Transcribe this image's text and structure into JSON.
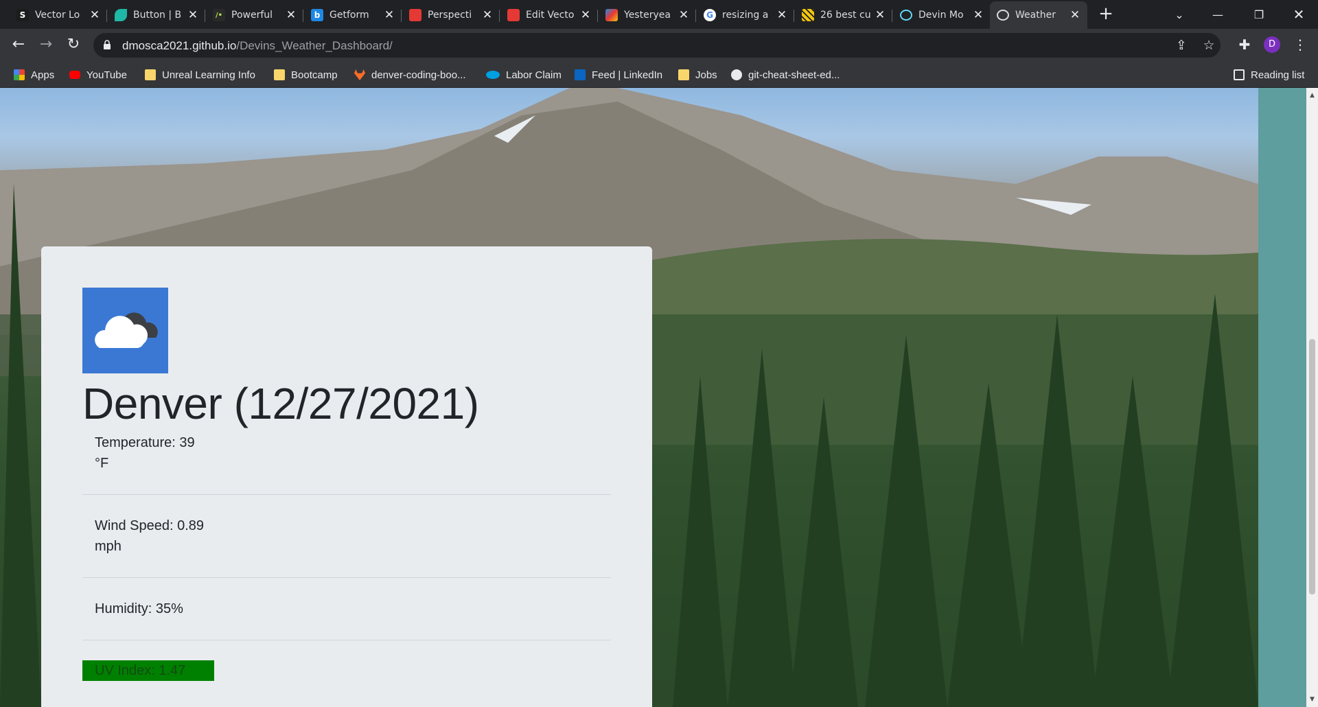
{
  "browser": {
    "tabs": [
      {
        "title": "Vector Lo",
        "favicon": "S",
        "color": "#1c1c1c"
      },
      {
        "title": "Button | B",
        "favicon": "",
        "color": "#1fb7a6"
      },
      {
        "title": "Powerful",
        "favicon": "/•",
        "color": "#2a2a2a"
      },
      {
        "title": "Getform",
        "favicon": "b",
        "color": "#1e88e5"
      },
      {
        "title": "Perspecti",
        "favicon": "",
        "color": "#e53935"
      },
      {
        "title": "Edit Vecto",
        "favicon": "",
        "color": "#e53935"
      },
      {
        "title": "Yesteryea",
        "favicon": "",
        "color": "#7b3fbf"
      },
      {
        "title": "resizing a",
        "favicon": "G",
        "color": "#ffffff"
      },
      {
        "title": "26 best cu",
        "favicon": "",
        "color": "#f2c511"
      },
      {
        "title": "Devin Mo",
        "favicon": "",
        "color": "#61dafb"
      },
      {
        "title": "Weather",
        "favicon": "",
        "color": "#9aa0a6"
      }
    ],
    "url_host": "dmosca2021.github.io",
    "url_path": "/Devins_Weather_Dashboard/",
    "profile_initial": "D",
    "bookmarks": [
      {
        "label": "Apps",
        "icon": "apps-grid-icon"
      },
      {
        "label": "YouTube",
        "icon": "youtube-icon"
      },
      {
        "label": "Unreal Learning Info",
        "icon": "folder-icon"
      },
      {
        "label": "Bootcamp",
        "icon": "folder-icon"
      },
      {
        "label": "denver-coding-boo...",
        "icon": "gitlab-icon"
      },
      {
        "label": "Labor Claim",
        "icon": "salesforce-icon"
      },
      {
        "label": "Feed | LinkedIn",
        "icon": "linkedin-icon"
      },
      {
        "label": "Jobs",
        "icon": "folder-icon"
      },
      {
        "label": "git-cheat-sheet-ed...",
        "icon": "github-icon"
      }
    ],
    "reading_list": "Reading list"
  },
  "weather": {
    "icon": "cloudy-icon",
    "city_date": "Denver (12/27/2021)",
    "temperature_label": "Temperature: 39",
    "temperature_unit": "°F",
    "wind_label": "Wind Speed: 0.89",
    "wind_unit": "mph",
    "humidity": "Humidity: 35%",
    "uv_index": "UV Index: 1.47",
    "uv_color": "#008000"
  }
}
